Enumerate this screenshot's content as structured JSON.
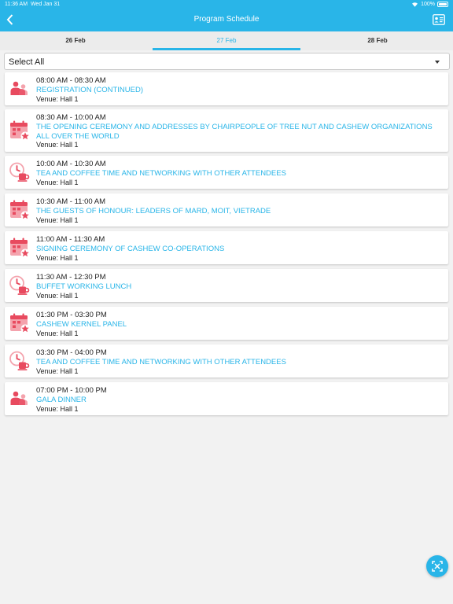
{
  "status": {
    "time": "11:36 AM",
    "date": "Wed Jan 31",
    "battery": "100%"
  },
  "header": {
    "title": "Program Schedule"
  },
  "tabs": [
    {
      "label": "26 Feb",
      "active": false
    },
    {
      "label": "27 Feb",
      "active": true
    },
    {
      "label": "28 Feb",
      "active": false
    }
  ],
  "filter": {
    "selected": "Select All"
  },
  "sessions": [
    {
      "time": "08:00 AM - 08:30 AM",
      "title": "REGISTRATION (CONTINUED)",
      "venue": "Venue: Hall 1",
      "icon": "people-icon"
    },
    {
      "time": "08:30 AM - 10:00 AM",
      "title": "THE OPENING CEREMONY AND ADDRESSES BY CHAIRPEOPLE OF TREE NUT AND CASHEW ORGANIZATIONS ALL OVER THE WORLD",
      "venue": "Venue: Hall 1",
      "icon": "calendar-star-icon"
    },
    {
      "time": "10:00 AM - 10:30 AM",
      "title": "TEA AND COFFEE TIME AND NETWORKING WITH OTHER ATTENDEES",
      "venue": "Venue: Hall 1",
      "icon": "clock-cup-icon"
    },
    {
      "time": "10:30 AM - 11:00 AM",
      "title": "THE GUESTS OF HONOUR: LEADERS OF MARD, MOIT, VIETRADE",
      "venue": "Venue: Hall 1",
      "icon": "calendar-star-icon"
    },
    {
      "time": "11:00 AM - 11:30 AM",
      "title": "SIGNING CEREMONY OF CASHEW CO-OPERATIONS",
      "venue": "Venue: Hall 1",
      "icon": "calendar-star-icon"
    },
    {
      "time": "11:30 AM - 12:30 PM",
      "title": "BUFFET WORKING LUNCH",
      "venue": "Venue: Hall 1",
      "icon": "clock-cup-icon"
    },
    {
      "time": "01:30 PM - 03:30 PM",
      "title": "CASHEW KERNEL PANEL",
      "venue": "Venue: Hall 1",
      "icon": "calendar-star-icon"
    },
    {
      "time": "03:30 PM - 04:00 PM",
      "title": "TEA AND COFFEE TIME AND NETWORKING WITH OTHER ATTENDEES",
      "venue": "Venue: Hall 1",
      "icon": "clock-cup-icon"
    },
    {
      "time": "07:00 PM - 10:00 PM",
      "title": "GALA DINNER",
      "venue": "Venue: Hall 1",
      "icon": "people-icon"
    }
  ],
  "colors": {
    "accent": "#29b5e8",
    "icon_red": "#e84a5f",
    "icon_pink": "#f4a3ad"
  }
}
